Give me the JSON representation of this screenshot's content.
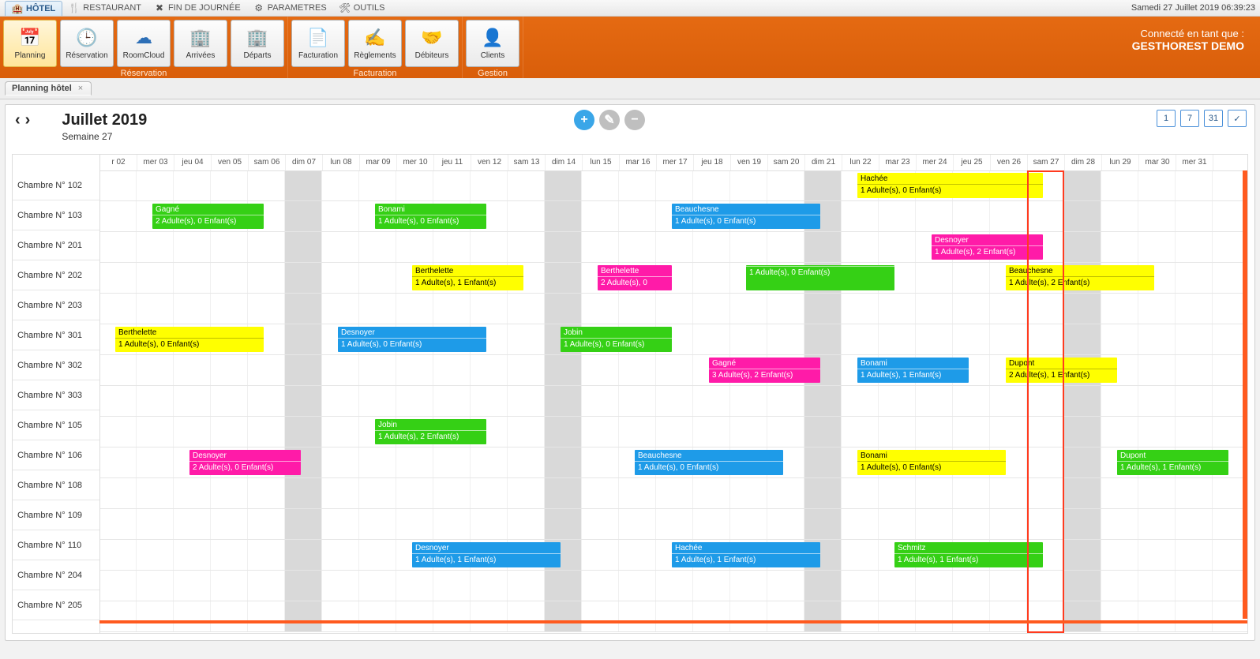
{
  "datetime": "Samedi 27 Juillet 2019 06:39:23",
  "menubar": [
    {
      "label": "HÔTEL",
      "icon": "🏨",
      "active": true
    },
    {
      "label": "RESTAURANT",
      "icon": "🍴",
      "active": false
    },
    {
      "label": "FIN DE JOURNÉE",
      "icon": "✖",
      "active": false
    },
    {
      "label": "PARAMETRES",
      "icon": "⚙",
      "active": false
    },
    {
      "label": "OUTILS",
      "icon": "🛠",
      "active": false
    }
  ],
  "ribbon_right": {
    "l1": "Connecté en tant que :",
    "l2": "GESTHOREST DEMO"
  },
  "ribbon_groups": [
    {
      "label": "Réservation",
      "buttons": [
        {
          "label": "Planning",
          "icon": "📅",
          "sel": true
        },
        {
          "label": "Réservation",
          "icon": "🕒",
          "sel": false
        },
        {
          "label": "RoomCloud",
          "icon": "☁",
          "sel": false
        },
        {
          "label": "Arrivées",
          "icon": "🏢",
          "sel": false
        },
        {
          "label": "Départs",
          "icon": "🏢",
          "sel": false
        }
      ]
    },
    {
      "label": "Facturation",
      "buttons": [
        {
          "label": "Facturation",
          "icon": "📄",
          "sel": false
        },
        {
          "label": "Règlements",
          "icon": "✍",
          "sel": false
        },
        {
          "label": "Débiteurs",
          "icon": "🤝",
          "sel": false
        }
      ]
    },
    {
      "label": "Gestion",
      "buttons": [
        {
          "label": "Clients",
          "icon": "👤",
          "sel": false
        }
      ]
    }
  ],
  "doc_tab": {
    "label": "Planning hôtel",
    "close": "×"
  },
  "header": {
    "month": "Juillet 2019",
    "week": "Semaine 27"
  },
  "view_buttons": [
    "1",
    "7",
    "31",
    "✓"
  ],
  "days": [
    {
      "lbl": "r 02",
      "sun": false
    },
    {
      "lbl": "mer 03",
      "sun": false
    },
    {
      "lbl": "jeu 04",
      "sun": false
    },
    {
      "lbl": "ven 05",
      "sun": false
    },
    {
      "lbl": "sam 06",
      "sun": false
    },
    {
      "lbl": "dim 07",
      "sun": true
    },
    {
      "lbl": "lun 08",
      "sun": false
    },
    {
      "lbl": "mar 09",
      "sun": false
    },
    {
      "lbl": "mer 10",
      "sun": false
    },
    {
      "lbl": "jeu 11",
      "sun": false
    },
    {
      "lbl": "ven 12",
      "sun": false
    },
    {
      "lbl": "sam 13",
      "sun": false
    },
    {
      "lbl": "dim 14",
      "sun": true
    },
    {
      "lbl": "lun 15",
      "sun": false
    },
    {
      "lbl": "mar 16",
      "sun": false
    },
    {
      "lbl": "mer 17",
      "sun": false
    },
    {
      "lbl": "jeu 18",
      "sun": false
    },
    {
      "lbl": "ven 19",
      "sun": false
    },
    {
      "lbl": "sam 20",
      "sun": false
    },
    {
      "lbl": "dim 21",
      "sun": true
    },
    {
      "lbl": "lun 22",
      "sun": false
    },
    {
      "lbl": "mar 23",
      "sun": false
    },
    {
      "lbl": "mer 24",
      "sun": false
    },
    {
      "lbl": "jeu 25",
      "sun": false
    },
    {
      "lbl": "ven 26",
      "sun": false
    },
    {
      "lbl": "sam 27",
      "sun": false
    },
    {
      "lbl": "dim 28",
      "sun": true
    },
    {
      "lbl": "lun 29",
      "sun": false
    },
    {
      "lbl": "mar 30",
      "sun": false
    },
    {
      "lbl": "mer 31",
      "sun": false
    }
  ],
  "today_col": 25,
  "rooms": [
    "Chambre N° 102",
    "Chambre N° 103",
    "Chambre N° 201",
    "Chambre N° 202",
    "Chambre N° 203",
    "Chambre N° 301",
    "Chambre N° 302",
    "Chambre N° 303",
    "Chambre N° 105",
    "Chambre N° 106",
    "Chambre N° 108",
    "Chambre N° 109",
    "Chambre N° 110",
    "Chambre N° 204",
    "Chambre N° 205"
  ],
  "reservations": [
    {
      "room": 0,
      "start": 20,
      "span": 5,
      "name": "Hachée",
      "detail": "1 Adulte(s), 0 Enfant(s)",
      "color": "yellow"
    },
    {
      "room": 1,
      "start": 1,
      "span": 3,
      "name": "Gagné",
      "detail": "2 Adulte(s), 0 Enfant(s)",
      "color": "green"
    },
    {
      "room": 1,
      "start": 7,
      "span": 3,
      "name": "Bonami",
      "detail": "1 Adulte(s), 0 Enfant(s)",
      "color": "green"
    },
    {
      "room": 1,
      "start": 15,
      "span": 4,
      "name": "Beauchesne",
      "detail": "1 Adulte(s), 0 Enfant(s)",
      "color": "blue"
    },
    {
      "room": 2,
      "start": 22,
      "span": 3,
      "name": "Desnoyer",
      "detail": "1 Adulte(s), 2 Enfant(s)",
      "color": "magenta"
    },
    {
      "room": 3,
      "start": 8,
      "span": 3,
      "name": "Berthelette",
      "detail": "1 Adulte(s), 1 Enfant(s)",
      "color": "yellow"
    },
    {
      "room": 3,
      "start": 13,
      "span": 2,
      "name": "Berthelette",
      "detail": "2 Adulte(s), 0",
      "color": "magenta"
    },
    {
      "room": 3,
      "start": 17,
      "span": 4,
      "name": "",
      "detail": "1 Adulte(s), 0 Enfant(s)",
      "color": "green"
    },
    {
      "room": 3,
      "start": 24,
      "span": 4,
      "name": "Beauchesne",
      "detail": "1 Adulte(s), 2 Enfant(s)",
      "color": "yellow"
    },
    {
      "room": 5,
      "start": 0,
      "span": 4,
      "name": "Berthelette",
      "detail": "1 Adulte(s), 0 Enfant(s)",
      "color": "yellow"
    },
    {
      "room": 5,
      "start": 6,
      "span": 4,
      "name": "Desnoyer",
      "detail": "1 Adulte(s), 0 Enfant(s)",
      "color": "blue"
    },
    {
      "room": 5,
      "start": 12,
      "span": 3,
      "name": "Jobin",
      "detail": "1 Adulte(s), 0 Enfant(s)",
      "color": "green"
    },
    {
      "room": 6,
      "start": 16,
      "span": 3,
      "name": "Gagné",
      "detail": "3 Adulte(s), 2 Enfant(s)",
      "color": "magenta"
    },
    {
      "room": 6,
      "start": 20,
      "span": 3,
      "name": "Bonami",
      "detail": "1 Adulte(s), 1 Enfant(s)",
      "color": "blue"
    },
    {
      "room": 6,
      "start": 24,
      "span": 3,
      "name": "Dupont",
      "detail": "2 Adulte(s), 1 Enfant(s)",
      "color": "yellow"
    },
    {
      "room": 8,
      "start": 7,
      "span": 3,
      "name": "Jobin",
      "detail": "1 Adulte(s), 2 Enfant(s)",
      "color": "green"
    },
    {
      "room": 9,
      "start": 2,
      "span": 3,
      "name": "Desnoyer",
      "detail": "2 Adulte(s), 0 Enfant(s)",
      "color": "magenta"
    },
    {
      "room": 9,
      "start": 14,
      "span": 4,
      "name": "Beauchesne",
      "detail": "1 Adulte(s), 0 Enfant(s)",
      "color": "blue"
    },
    {
      "room": 9,
      "start": 20,
      "span": 4,
      "name": "Bonami",
      "detail": "1 Adulte(s), 0 Enfant(s)",
      "color": "yellow"
    },
    {
      "room": 9,
      "start": 27,
      "span": 3,
      "name": "Dupont",
      "detail": "1 Adulte(s), 1 Enfant(s)",
      "color": "green"
    },
    {
      "room": 12,
      "start": 8,
      "span": 4,
      "name": "Desnoyer",
      "detail": "1 Adulte(s), 1 Enfant(s)",
      "color": "blue"
    },
    {
      "room": 12,
      "start": 15,
      "span": 4,
      "name": "Hachée",
      "detail": "1 Adulte(s), 1 Enfant(s)",
      "color": "blue"
    },
    {
      "room": 12,
      "start": 21,
      "span": 4,
      "name": "Schmitz",
      "detail": "1 Adulte(s), 1 Enfant(s)",
      "color": "green"
    }
  ]
}
